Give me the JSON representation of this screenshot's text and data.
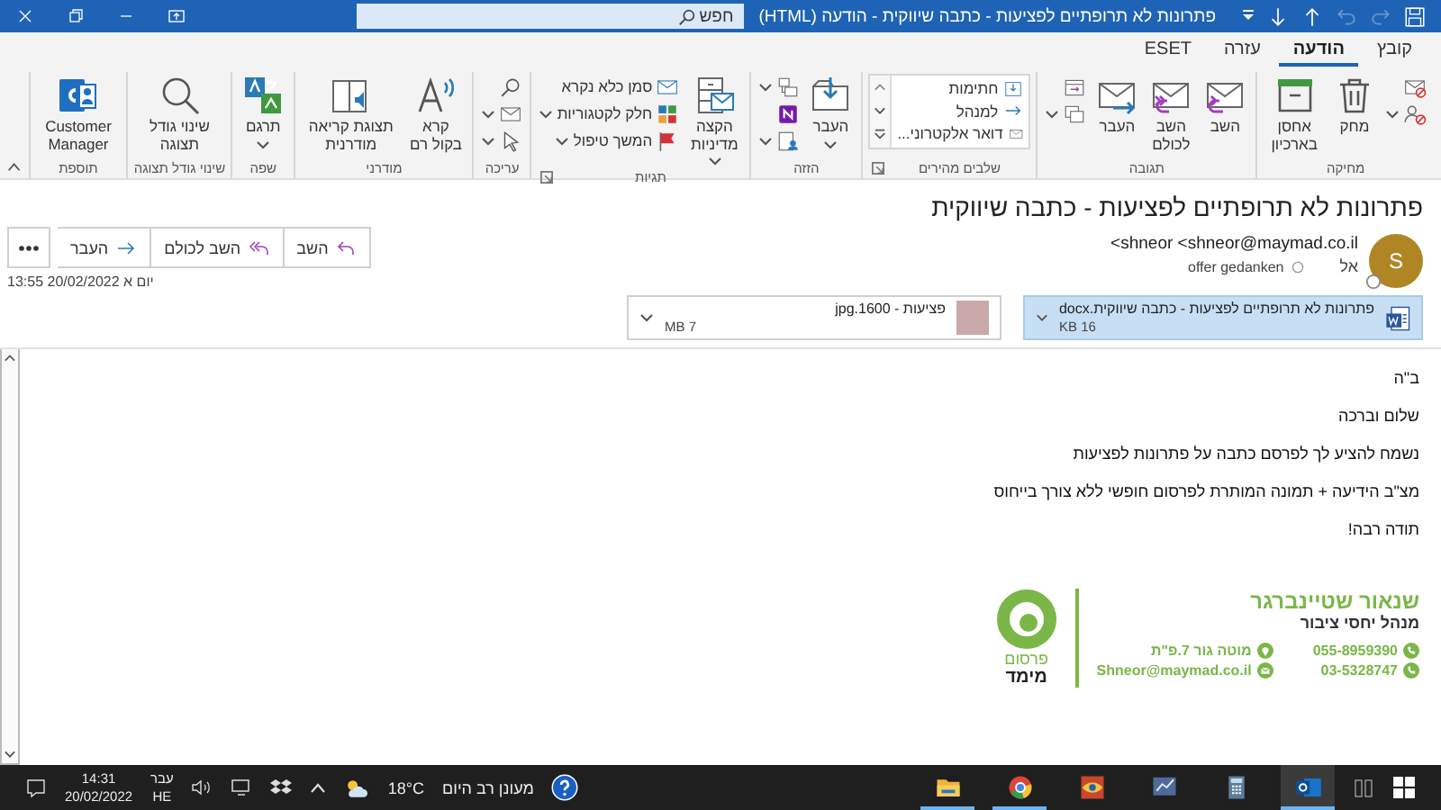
{
  "title_bar": {
    "quick_access": [
      {
        "disabled": false
      },
      {
        "disabled": true
      },
      {
        "disabled": true
      },
      {
        "disabled": false
      },
      {
        "disabled": false
      }
    ],
    "title": "פתרונות לא תרופתיים לפציעות - כתבה שיווקית - הודעה (HTML)",
    "search": {
      "placeholder": "חפש"
    }
  },
  "tabs": [
    {
      "label": "קובץ",
      "selected": false
    },
    {
      "label": "הודעה",
      "selected": true
    },
    {
      "label": "עזרה",
      "selected": false
    },
    {
      "label": "ESET",
      "selected": false
    }
  ],
  "ribbon": {
    "groups": [
      {
        "label": "מחיקה",
        "items": [
          {
            "kind": "icon"
          },
          {
            "kind": "icon",
            "dropdown": true
          },
          {
            "kind": "large",
            "label": "מחק"
          },
          {
            "kind": "large",
            "label": "אחסן בארכיון"
          }
        ]
      },
      {
        "label": "תגובה",
        "items": [
          {
            "kind": "large",
            "label": "השב"
          },
          {
            "kind": "large",
            "label": "השב לכולם"
          },
          {
            "kind": "large",
            "label": "העבר"
          },
          {
            "kind": "icon"
          },
          {
            "kind": "icon",
            "dropdown": true
          }
        ]
      },
      {
        "label": "שלבים מהירים",
        "launcher": true,
        "items": [
          {
            "kind": "quickstep",
            "label": "חתימות"
          },
          {
            "kind": "quickstep",
            "label": "למנהל"
          },
          {
            "kind": "quickstep",
            "label": "דואר אלקטרוני..."
          }
        ]
      },
      {
        "label": "הזזה",
        "items": [
          {
            "kind": "large",
            "label": "העבר",
            "dropdown": true
          },
          {
            "kind": "icon",
            "dropdown": true
          },
          {
            "kind": "icon"
          },
          {
            "kind": "icon",
            "dropdown": true
          }
        ]
      },
      {
        "label": "תגיות",
        "launcher": true,
        "items": [
          {
            "kind": "large",
            "label": "הקצה מדיניות",
            "dropdown": true
          },
          {
            "kind": "small",
            "label": "סמן כלא נקרא"
          },
          {
            "kind": "small",
            "label": "חלק לקטגוריות",
            "dropdown": true
          },
          {
            "kind": "small",
            "label": "המשך טיפול",
            "dropdown": true
          }
        ]
      },
      {
        "label": "עריכה",
        "items": [
          {
            "kind": "icon"
          },
          {
            "kind": "icon",
            "dropdown": true
          },
          {
            "kind": "icon",
            "dropdown": true
          }
        ]
      },
      {
        "label": "מודרני",
        "items": [
          {
            "kind": "large",
            "label": "קרא בקול רם"
          },
          {
            "kind": "large",
            "label": "תצוגת קריאה מודרנית"
          }
        ]
      },
      {
        "label": "שפה",
        "items": [
          {
            "kind": "large",
            "label": "תרגם",
            "dropdown": true
          }
        ]
      },
      {
        "label": "שינוי גודל תצוגה",
        "items": [
          {
            "kind": "large",
            "label": "שינוי גודל תצוגה"
          }
        ]
      },
      {
        "label": "תוספת",
        "items": [
          {
            "kind": "large",
            "label": "Customer Manager"
          }
        ]
      }
    ]
  },
  "message": {
    "subject": "פתרונות לא תרופתיים לפציעות - כתבה שיווקית",
    "avatar": "S",
    "sender": "shneor <shneor@maymad.co.il>",
    "to_label": "אל",
    "recipient": "offer gedanken",
    "actions": [
      "השב",
      "השב לכולם",
      "העבר"
    ],
    "date": "יום א 20/02/2022 13:55",
    "attachments": [
      {
        "kind": "document",
        "name": "פתרונות לא תרופתיים לפציעות - כתבה שיווקית.docx",
        "size": "16 KB",
        "selected": true
      },
      {
        "kind": "image",
        "name": "פציעות - 1600.jpg",
        "size": "7 MB",
        "selected": false
      }
    ]
  },
  "body": {
    "paragraphs": [
      "ב\"ה",
      "שלום וברכה",
      "נשמח להציע לך לפרסם כתבה על פתרונות לפציעות",
      "מצ\"ב הידיעה + תמונה המותרת לפרסום חופשי ללא צורך בייחוס",
      "תודה רבה!"
    ],
    "signature": {
      "name": "שנאור שטיינברגר",
      "role": "מנהל יחסי ציבור",
      "contacts": [
        {
          "kind": "phone",
          "text": "055-8959390"
        },
        {
          "kind": "address",
          "text": "מוטה גור 7.פ\"ת"
        },
        {
          "kind": "phone",
          "text": "03-5328747"
        },
        {
          "kind": "email",
          "text": "Shneor@maymad.co.il"
        }
      ],
      "logo": {
        "line_1": "פרסום",
        "line_2": "מימד"
      }
    }
  },
  "taskbar": {
    "apps": [
      {
        "running": true,
        "selected": true
      },
      {
        "running": false,
        "selected": false
      },
      {
        "running": false,
        "selected": false
      },
      {
        "running": false,
        "selected": false
      },
      {
        "running": true,
        "selected": false
      },
      {
        "running": true,
        "selected": false
      }
    ],
    "weather": {
      "text": "מעונן רב היום",
      "temperature": "18°C"
    },
    "language": {
      "name": "עבר",
      "code": "HE"
    },
    "clock": {
      "time": "14:31",
      "date": "20/02/2022"
    }
  }
}
